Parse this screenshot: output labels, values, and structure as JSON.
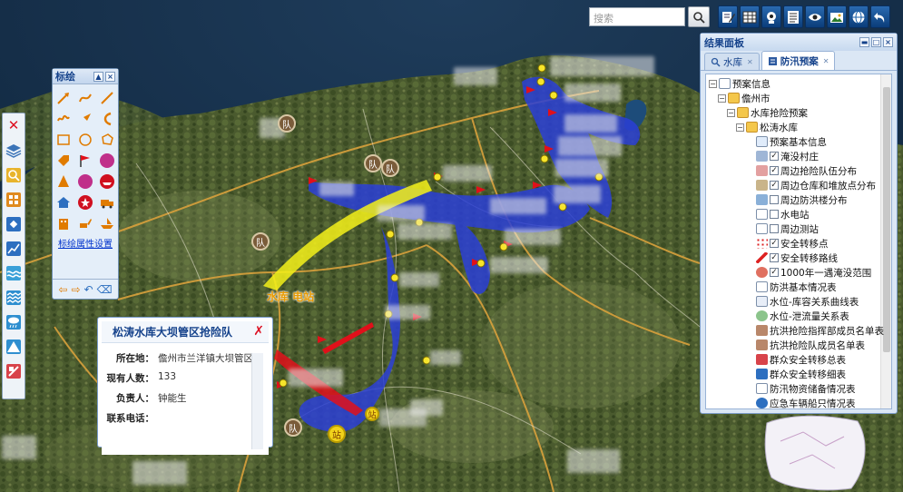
{
  "search": {
    "placeholder": "搜索"
  },
  "toolbar": {
    "tools": [
      "edit-icon",
      "table-icon",
      "webcam-icon",
      "list-icon",
      "eye-icon",
      "image-icon",
      "globe-icon",
      "back-arrow-icon"
    ]
  },
  "draw_panel": {
    "title": "标绘",
    "link": "标绘属性设置"
  },
  "map": {
    "place_label": "水库 电站",
    "badge_team": "队",
    "badge_station": "站"
  },
  "popup": {
    "title": "松涛水库大坝管区抢险队",
    "rows": [
      {
        "key": "所在地：",
        "value": "儋州市兰洋镇大坝管区"
      },
      {
        "key": "现有人数：",
        "value": "133"
      },
      {
        "key": "负责人：",
        "value": "钟能生"
      },
      {
        "key": "联系电话：",
        "value": ""
      }
    ]
  },
  "results_panel": {
    "title": "结果面板",
    "tabs": [
      {
        "label": "水库"
      },
      {
        "label": "防汛预案"
      }
    ],
    "tree": [
      {
        "label": "预案信息"
      },
      {
        "label": "儋州市"
      },
      {
        "label": "水库抢险预案"
      },
      {
        "label": "松涛水库"
      },
      {
        "label": "预案基本信息"
      },
      {
        "label": "淹没村庄"
      },
      {
        "label": "周边抢险队伍分布"
      },
      {
        "label": "周边仓库和堆放点分布"
      },
      {
        "label": "周边防洪楼分布"
      },
      {
        "label": "水电站"
      },
      {
        "label": "周边测站"
      },
      {
        "label": "安全转移点"
      },
      {
        "label": "安全转移路线"
      },
      {
        "label": "1000年一遇淹没范围"
      },
      {
        "label": "防洪基本情况表"
      },
      {
        "label": "水位-库容关系曲线表"
      },
      {
        "label": "水位-泄流量关系表"
      },
      {
        "label": "抗洪抢险指挥部成员名单表"
      },
      {
        "label": "抗洪抢险队成员名单表"
      },
      {
        "label": "群众安全转移总表"
      },
      {
        "label": "群众安全转移细表"
      },
      {
        "label": "防汛物资储备情况表"
      },
      {
        "label": "应急车辆船只情况表"
      }
    ]
  },
  "colors": {
    "panel_blue": "#15428b",
    "flood_area": "#2b3fd6",
    "route_yellow": "#f4f11a",
    "route_red": "#e0101a"
  }
}
